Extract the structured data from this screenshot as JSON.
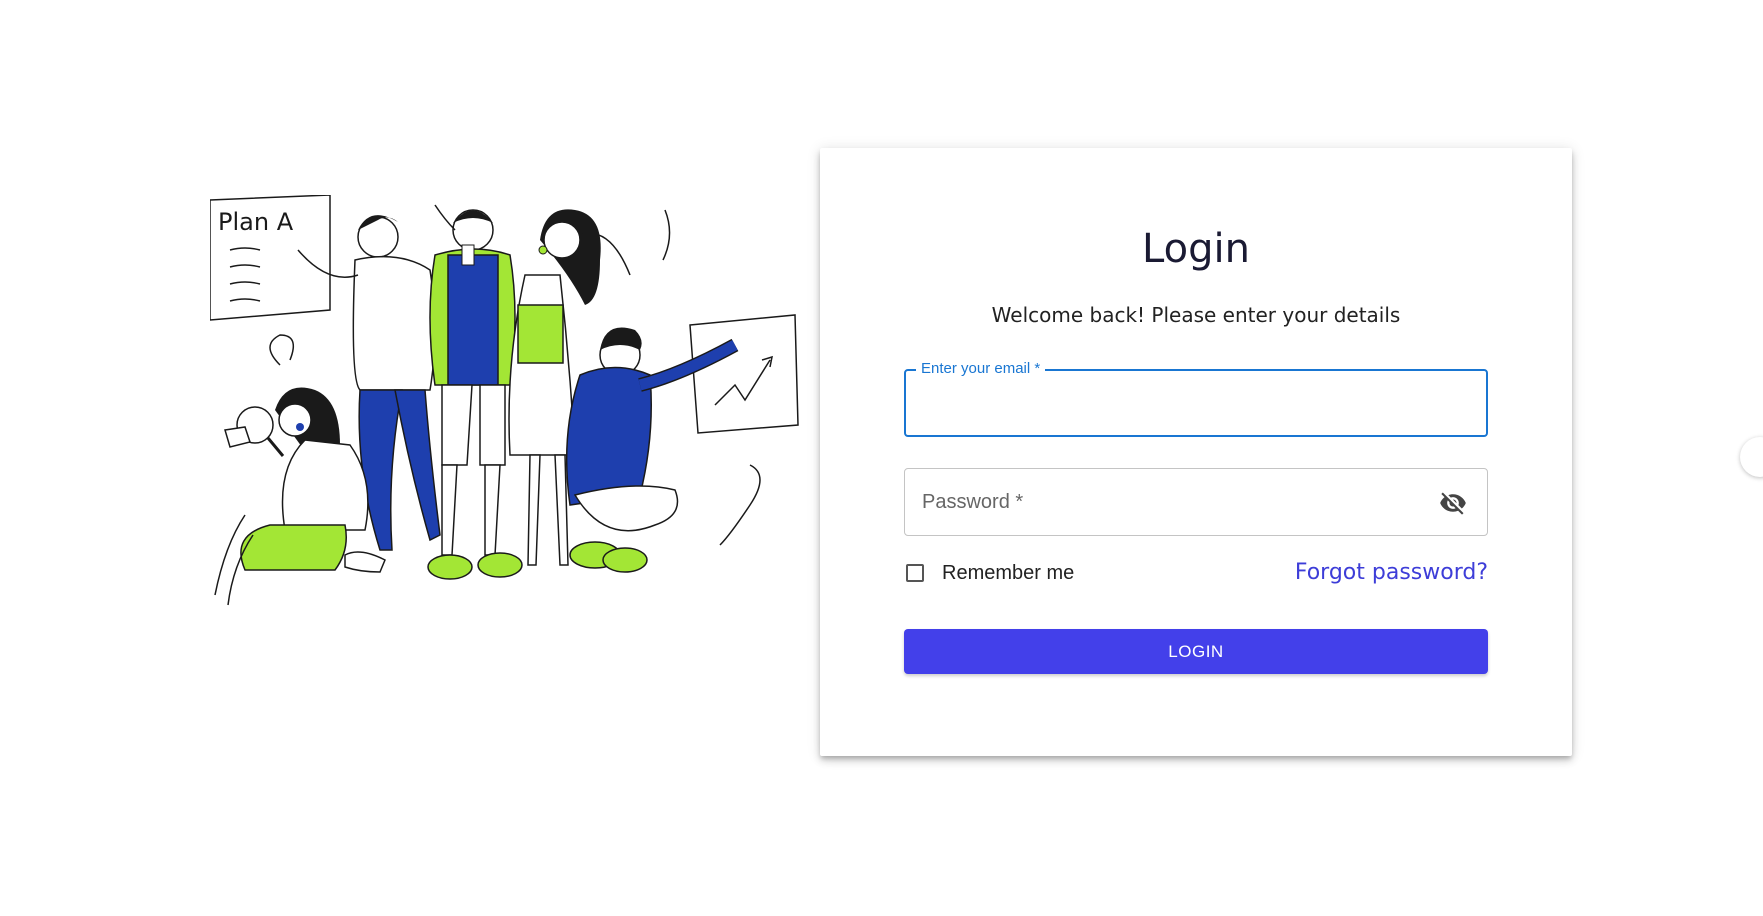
{
  "illustration": {
    "board_text": "Plan A",
    "colors": {
      "accent_green": "#a3e635",
      "accent_blue": "#1e3fae",
      "line": "#1a1a1a"
    }
  },
  "login": {
    "title": "Login",
    "subtitle": "Welcome back! Please enter your details",
    "email": {
      "label": "Enter your email *",
      "value": ""
    },
    "password": {
      "label": "Password *",
      "visibility_icon": "eye-off-icon"
    },
    "remember_me": {
      "label": "Remember me",
      "checked": false
    },
    "forgot_password": "Forgot password?",
    "submit_label": "LOGIN",
    "colors": {
      "primary": "#4340ea",
      "focus": "#1976d2",
      "link": "#3d3dd8"
    }
  }
}
